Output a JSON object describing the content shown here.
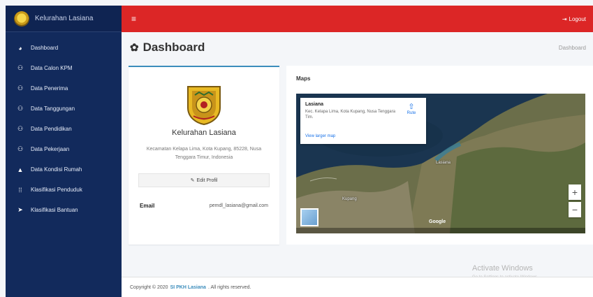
{
  "sidebar": {
    "brand": "Kelurahan Lasiana",
    "items": [
      {
        "label": "Dashboard",
        "icon": "dashboard-icon",
        "glyph": "◕"
      },
      {
        "label": "Data Calon KPM",
        "icon": "users-icon",
        "glyph": "⚇"
      },
      {
        "label": "Data Penerima",
        "icon": "users-icon",
        "glyph": "⚇"
      },
      {
        "label": "Data Tanggungan",
        "icon": "users-icon",
        "glyph": "⚇"
      },
      {
        "label": "Data Pendidikan",
        "icon": "users-icon",
        "glyph": "⚇"
      },
      {
        "label": "Data Pekerjaan",
        "icon": "users-icon",
        "glyph": "⚇"
      },
      {
        "label": "Data Kondisi Rumah",
        "icon": "user-icon",
        "glyph": "▲"
      },
      {
        "label": "Klasifikasi Penduduk",
        "icon": "list-icon",
        "glyph": "⁞⁞"
      },
      {
        "label": "Klasifikasi Bantuan",
        "icon": "paper-plane-icon",
        "glyph": "➤"
      }
    ]
  },
  "topbar": {
    "menu_glyph": "≡",
    "logout_label": "Logout",
    "logout_glyph": "⇥"
  },
  "header": {
    "title": "Dashboard",
    "title_glyph": "✿",
    "breadcrumb": "Dashboard"
  },
  "profile": {
    "name": "Kelurahan Lasiana",
    "address": "Kecamatan Kelapa Lima, Kota Kupang, 85228, Nusa Tenggara Timur, Indonesia",
    "edit_label": "Edit Profil",
    "edit_glyph": "✎",
    "email_label": "Email",
    "email_value": "pemdl_lasiana@gmail.com"
  },
  "maps": {
    "title": "Maps",
    "info_name": "Lasiana",
    "info_address": "Kec. Kelapa Lima, Kota Kupang, Nusa Tenggara Tim.",
    "info_link": "View larger map",
    "directions_label": "Rute",
    "directions_glyph": "⇧",
    "zoom_in": "+",
    "zoom_out": "−",
    "logo": "Google",
    "place_labels": [
      "Lasiana",
      "Kupang"
    ]
  },
  "footer": {
    "prefix": "Copyright © 2020",
    "brand": "SI PKH Lasiana",
    "suffix": ". All rights reserved."
  },
  "watermark": {
    "title": "Activate Windows",
    "subtitle": "Go to Settings to activate Windows."
  },
  "colors": {
    "sidebar": "#122a5c",
    "topbar": "#dc2626",
    "accent": "#3c8dbc"
  }
}
